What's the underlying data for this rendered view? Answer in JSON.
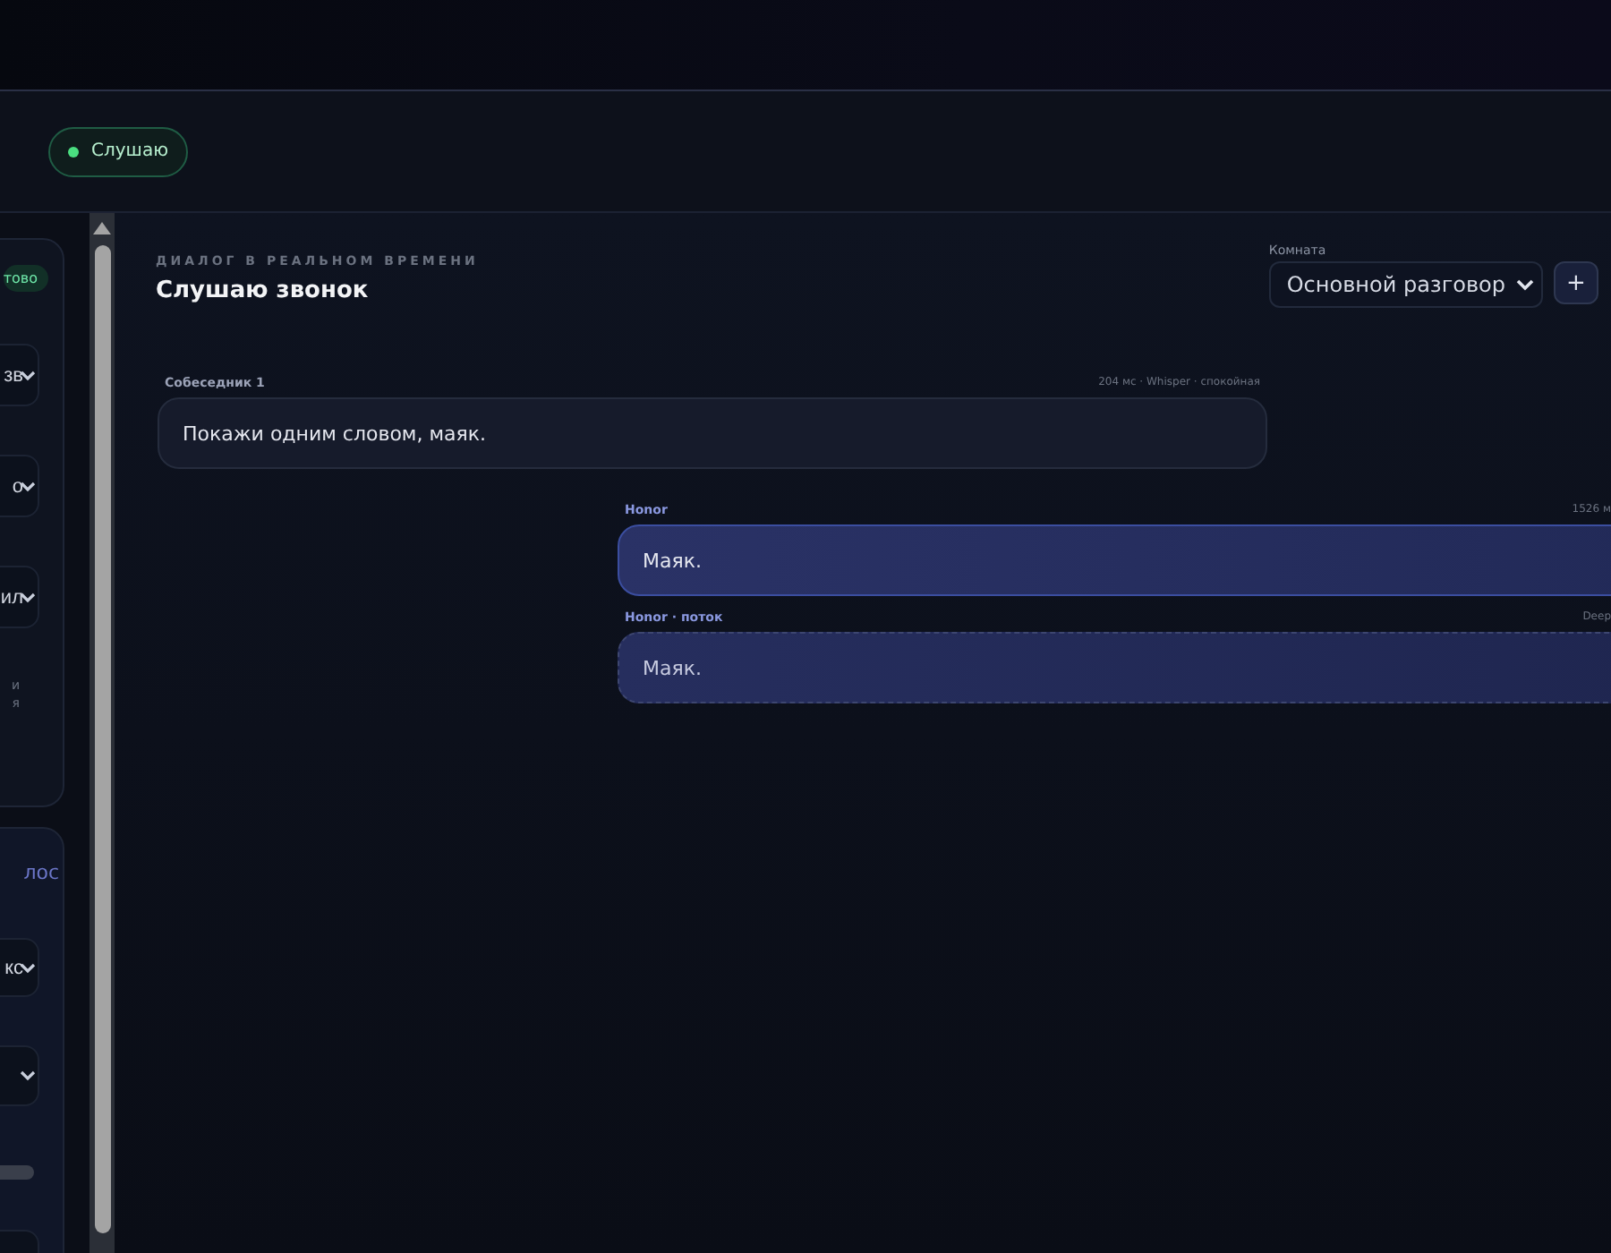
{
  "header": {
    "status": {
      "label": "Слушаю",
      "active": true
    }
  },
  "sidebar": {
    "cards": [
      {
        "items": [
          {
            "kind": "badge",
            "text": "тово"
          },
          {
            "kind": "select",
            "value": "зв"
          },
          {
            "kind": "select",
            "value": "о"
          },
          {
            "kind": "select",
            "value": "ил"
          },
          {
            "kind": "note",
            "text": "и"
          },
          {
            "kind": "note",
            "text": "я"
          }
        ]
      },
      {
        "items": [
          {
            "kind": "title",
            "text": "лос"
          },
          {
            "kind": "select",
            "value": "кс"
          },
          {
            "kind": "select"
          },
          {
            "kind": "track"
          },
          {
            "kind": "select"
          }
        ]
      }
    ]
  },
  "dialog": {
    "eyebrow": "ДИАЛОГ В РЕАЛЬНОМ ВРЕМЕНИ",
    "title": "Слушаю звонок",
    "room": {
      "label": "Комната",
      "value": "Основной разговор",
      "add": "+"
    }
  },
  "messages": [
    {
      "kind": "user",
      "author": "Собеседник 1",
      "meta": "204 мс · Whisper · спокойная",
      "text": "Покажи одним словом, маяк.",
      "streaming": false
    },
    {
      "kind": "assistant",
      "author": "Honor",
      "meta": "1526 м",
      "text": "Маяк.",
      "streaming": false
    },
    {
      "kind": "assistant",
      "author": "Honor · поток",
      "meta": "Deep",
      "text": "Маяк.",
      "streaming": true
    }
  ]
}
